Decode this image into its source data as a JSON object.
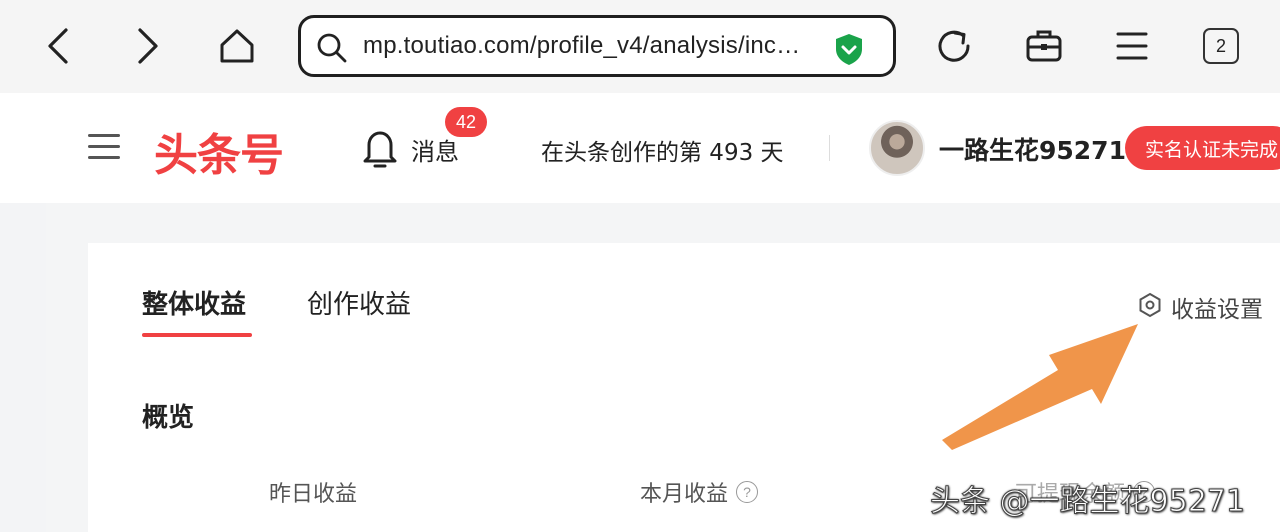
{
  "browser": {
    "url": "mp.toutiao.com/profile_v4/analysis/inc…",
    "tab_count": "2",
    "icons": [
      "back-icon",
      "forward-icon",
      "home-icon",
      "search-icon",
      "secure-shield-icon",
      "reload-icon",
      "toolbox-icon",
      "menu-icon",
      "tabs-icon"
    ],
    "shield_color": "#1aa34a"
  },
  "header": {
    "logo": "头条号",
    "messages_label": "消息",
    "messages_badge": "42",
    "days_text": "在头条创作的第 493 天",
    "username": "一路生花95271",
    "verify_button": "实名认证未完成",
    "brand_color": "#f04142"
  },
  "tabs": [
    {
      "label": "整体收益",
      "active": true
    },
    {
      "label": "创作收益",
      "active": false
    }
  ],
  "settings_label": "收益设置",
  "overview_title": "概览",
  "metrics": [
    {
      "label": "昨日收益"
    },
    {
      "label": "本月收益"
    },
    {
      "label": "可提现余额"
    }
  ],
  "watermark": "头条 @一路生花95271",
  "annotation_arrow_color": "#f0954a"
}
